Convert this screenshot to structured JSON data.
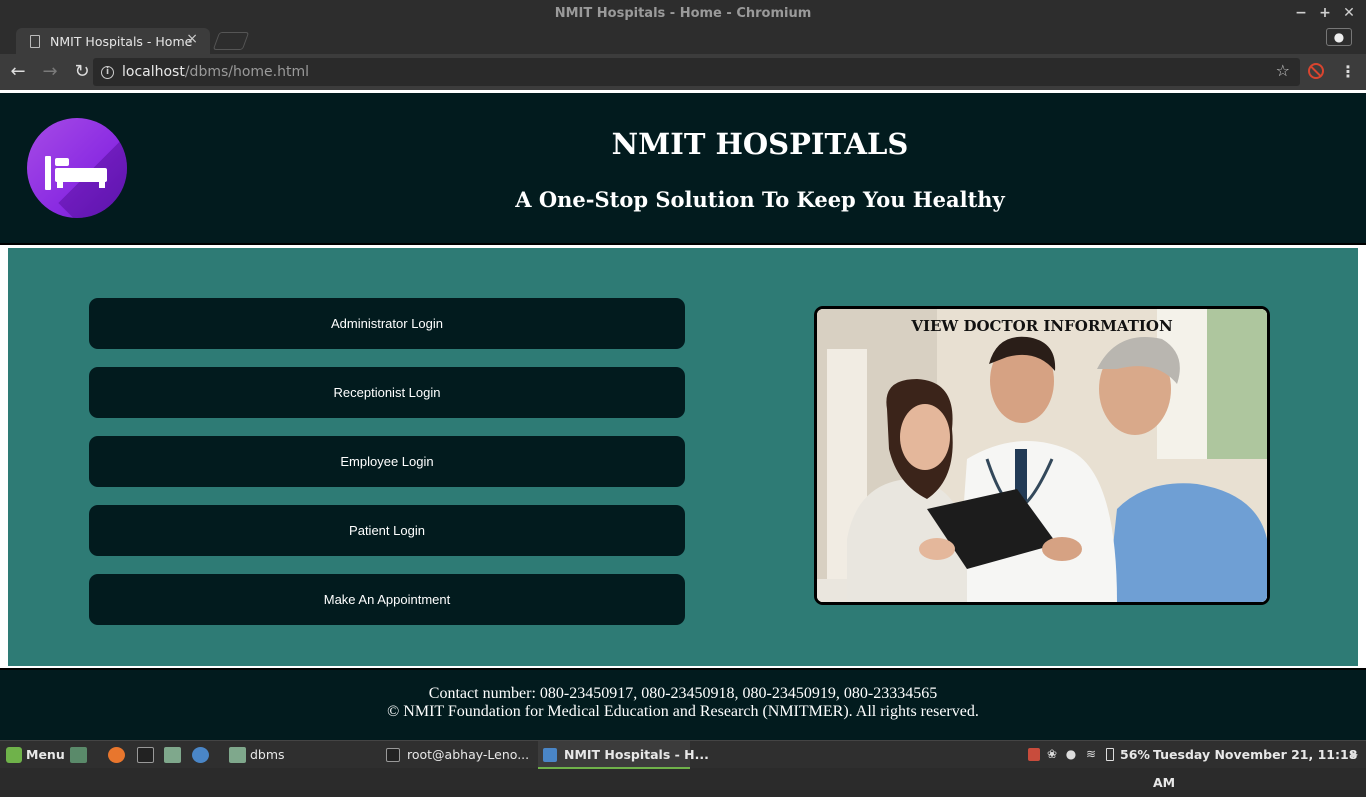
{
  "window": {
    "title": "NMIT Hospitals - Home - Chromium",
    "controls": [
      "−",
      "+",
      "✕"
    ]
  },
  "browser": {
    "tab_title": "NMIT Hospitals - Home",
    "tab_close": "×",
    "url_host": "localhost",
    "url_path": "/dbms/home.html",
    "back": "←",
    "forward": "→",
    "reload": "↻",
    "star": "☆",
    "menu": "⋮",
    "profile": "●",
    "info": "i"
  },
  "header": {
    "title": "NMIT HOSPITALS",
    "subtitle": "A One-Stop Solution To Keep You Healthy",
    "logo_icon": "bed-icon",
    "logo_color": "#8a2be2"
  },
  "logins": [
    {
      "label": "Administrator Login"
    },
    {
      "label": "Receptionist Login"
    },
    {
      "label": "Employee Login"
    },
    {
      "label": "Patient Login"
    },
    {
      "label": "Make An Appointment"
    }
  ],
  "doctor_card": {
    "title": "VIEW DOCTOR INFORMATION"
  },
  "footer": {
    "contact": "Contact number: 080-23450917, 080-23450918, 080-23450919, 080-23334565",
    "copyright": "© NMIT Foundation for Medical Education and Research (NMITMER). All rights reserved."
  },
  "taskbar": {
    "menu_label": "Menu",
    "folder_label": "dbms",
    "terminal_label": "root@abhay-Leno...",
    "browser_label": "NMIT Hospitals - H...",
    "battery": "56%",
    "clock": "Tuesday November 21, 11:18 AM"
  },
  "colors": {
    "header_bg": "#021b1e",
    "main_bg": "#2e7b75",
    "button_bg": "#021b1e"
  }
}
